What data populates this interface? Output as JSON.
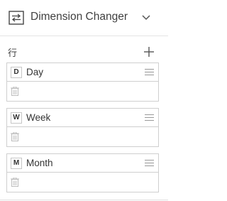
{
  "header": {
    "title": "Dimension Changer",
    "icon": "swap-arrows-icon",
    "collapse_icon": "chevron-down-icon"
  },
  "section": {
    "label": "行",
    "add_icon": "plus-icon"
  },
  "items": [
    {
      "badge": "D",
      "label": "Day"
    },
    {
      "badge": "W",
      "label": "Week"
    },
    {
      "badge": "M",
      "label": "Month"
    }
  ],
  "colors": {
    "border": "#cfcfcf",
    "icon": "#555555",
    "muted_icon": "#bdbdbd",
    "text": "#333333"
  }
}
